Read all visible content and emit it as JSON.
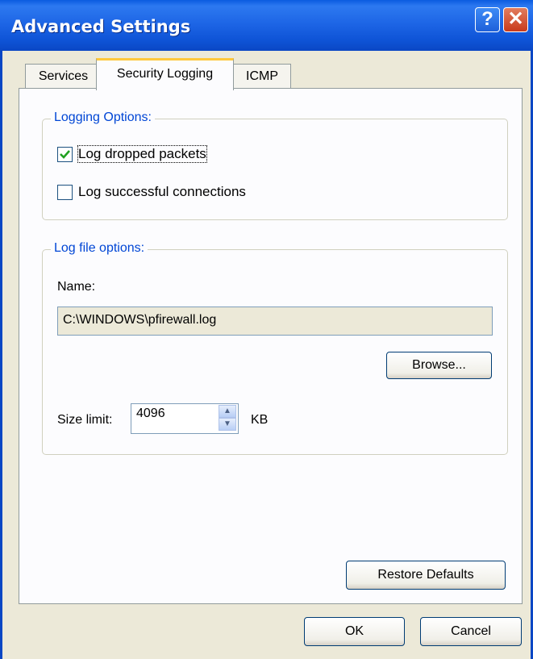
{
  "window": {
    "title": "Advanced Settings",
    "help_glyph": "?",
    "close_glyph": "✕"
  },
  "tabs": [
    {
      "label": "Services",
      "selected": false
    },
    {
      "label": "Security Logging",
      "selected": true
    },
    {
      "label": "ICMP",
      "selected": false
    }
  ],
  "logging_options": {
    "legend": "Logging Options:",
    "log_dropped": {
      "label": "Log dropped packets",
      "checked": true
    },
    "log_successful": {
      "label": "Log successful connections",
      "checked": false
    }
  },
  "log_file": {
    "legend": "Log file options:",
    "name_label": "Name:",
    "name_value": "C:\\WINDOWS\\pfirewall.log",
    "browse_label": "Browse...",
    "size_label": "Size limit:",
    "size_value": "4096",
    "size_unit": "KB"
  },
  "buttons": {
    "restore": "Restore Defaults",
    "ok": "OK",
    "cancel": "Cancel"
  },
  "colors": {
    "titlebar": "#0A5BE0",
    "dialog_bg": "#ECE9D8",
    "group_label": "#0046D5",
    "tab_highlight": "#FFC83C"
  }
}
